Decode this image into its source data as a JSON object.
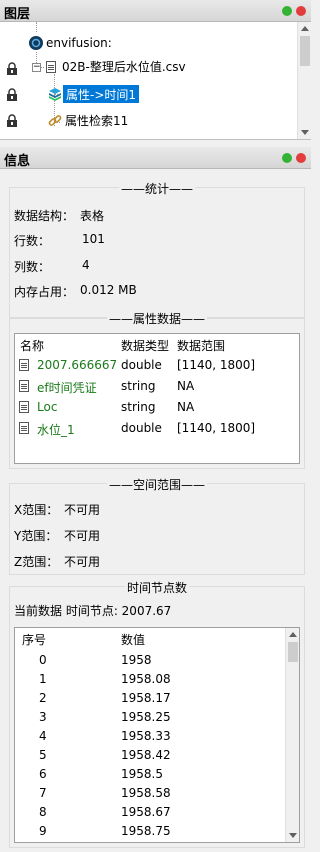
{
  "layers_panel": {
    "title": "图层",
    "items": [
      {
        "label": "envifusion:"
      },
      {
        "label": "02B-整理后水位值.csv"
      },
      {
        "label": "属性->时间1"
      },
      {
        "label": "属性检索11"
      }
    ]
  },
  "info_panel": {
    "title": "信息",
    "stats": {
      "title": "统计",
      "rows": [
        {
          "label": "数据结构：",
          "value": "表格"
        },
        {
          "label": "行数：",
          "value": "101"
        },
        {
          "label": "列数：",
          "value": "4"
        },
        {
          "label": "内存占用：",
          "value": "0.012 MB"
        }
      ]
    },
    "attributes": {
      "title": "属性数据",
      "columns": [
        "名称",
        "数据类型",
        "数据范围"
      ],
      "rows": [
        {
          "name": "2007.666667",
          "type": "double",
          "range": "[1140, 1800]"
        },
        {
          "name": "ef时间凭证",
          "type": "string",
          "range": "NA"
        },
        {
          "name": "Loc",
          "type": "string",
          "range": "NA"
        },
        {
          "name": "水位_1",
          "type": "double",
          "range": "[1140, 1800]"
        }
      ]
    },
    "spatial": {
      "title": "空间范围",
      "rows": [
        {
          "label": "X范围：",
          "value": "不可用"
        },
        {
          "label": "Y范围：",
          "value": "不可用"
        },
        {
          "label": "Z范围：",
          "value": "不可用"
        }
      ]
    },
    "time": {
      "title": "时间节点数",
      "current": "当前数据 时间节点: 2007.67",
      "columns": [
        "序号",
        "数值"
      ],
      "rows": [
        {
          "idx": "0",
          "val": "1958"
        },
        {
          "idx": "1",
          "val": "1958.08"
        },
        {
          "idx": "2",
          "val": "1958.17"
        },
        {
          "idx": "3",
          "val": "1958.25"
        },
        {
          "idx": "4",
          "val": "1958.33"
        },
        {
          "idx": "5",
          "val": "1958.42"
        },
        {
          "idx": "6",
          "val": "1958.5"
        },
        {
          "idx": "7",
          "val": "1958.58"
        },
        {
          "idx": "8",
          "val": "1958.67"
        },
        {
          "idx": "9",
          "val": "1958.75"
        }
      ]
    }
  },
  "colors": {
    "accent_selection": "#0078d7",
    "dot_green": "#33b233",
    "dot_red": "#e23c3c",
    "field_green": "#1a7a1a"
  }
}
